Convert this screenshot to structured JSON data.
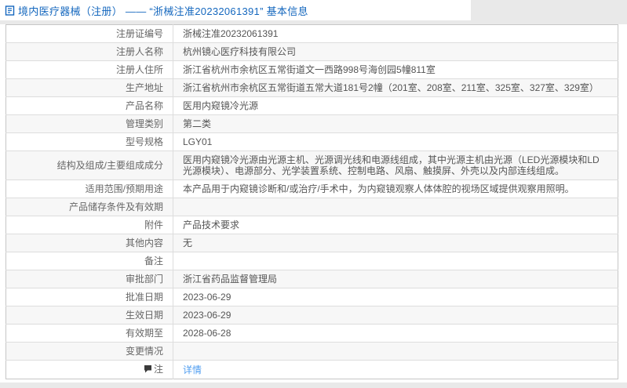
{
  "page": {
    "title": "境内医疗器械（注册） ——  “浙械注准20232061391” 基本信息",
    "title_color": "#1467be",
    "link_color": "#4f9df0",
    "row_alt_color": "#f7f7f7"
  },
  "table": {
    "rows": [
      {
        "label": "注册证编号",
        "value": "浙械注准20232061391"
      },
      {
        "label": "注册人名称",
        "value": "杭州镜心医疗科技有限公司"
      },
      {
        "label": "注册人住所",
        "value": "浙江省杭州市余杭区五常街道文一西路998号海创园5幢811室"
      },
      {
        "label": "生产地址",
        "value": "浙江省杭州市余杭区五常街道五常大道181号2幢（201室、208室、211室、325室、327室、329室）"
      },
      {
        "label": "产品名称",
        "value": "医用内窥镜冷光源"
      },
      {
        "label": "管理类别",
        "value": "第二类"
      },
      {
        "label": "型号规格",
        "value": "LGY01"
      },
      {
        "label": "结构及组成/主要组成成分",
        "value": "医用内窥镜冷光源由光源主机、光源调光线和电源线组成，其中光源主机由光源（LED光源模块和LD光源模块）、电源部分、光学装置系统、控制电路、风扇、触摸屏、外壳以及内部连线组成。"
      },
      {
        "label": "适用范围/预期用途",
        "value": "本产品用于内窥镜诊断和/或治疗/手术中，为内窥镜观察人体体腔的视场区域提供观察用照明。"
      },
      {
        "label": "产品储存条件及有效期",
        "value": ""
      },
      {
        "label": "附件",
        "value": "产品技术要求"
      },
      {
        "label": "其他内容",
        "value": "无"
      },
      {
        "label": "备注",
        "value": ""
      },
      {
        "label": "审批部门",
        "value": "浙江省药品监督管理局"
      },
      {
        "label": "批准日期",
        "value": "2023-06-29"
      },
      {
        "label": "生效日期",
        "value": "2023-06-29"
      },
      {
        "label": "有效期至",
        "value": "2028-06-28"
      },
      {
        "label": "变更情况",
        "value": ""
      },
      {
        "label": "注",
        "label_icon": "comment-icon",
        "value": "详情",
        "value_is_link": true
      }
    ]
  }
}
